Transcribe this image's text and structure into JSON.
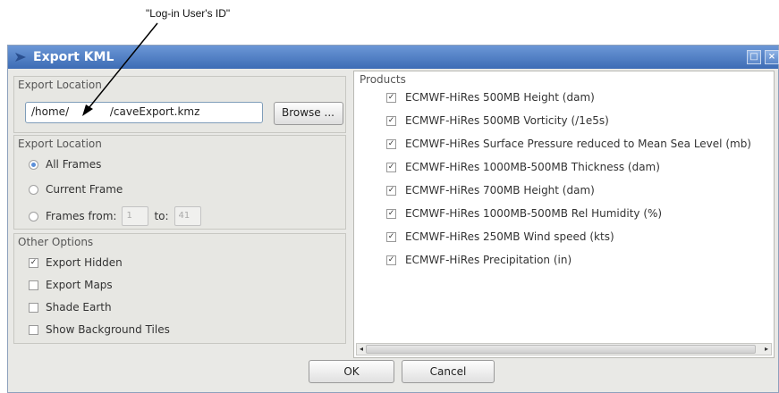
{
  "annotation": {
    "text": "\"Log-in User's ID\""
  },
  "window": {
    "title": "Export KML",
    "buttons": {
      "maximize": "□",
      "close": "×"
    }
  },
  "export_location_path": {
    "label": "Export Location",
    "value": "/home/            /caveExport.kmz",
    "browse_label": "Browse ..."
  },
  "export_frames": {
    "label": "Export Location",
    "options": [
      {
        "label": "All Frames",
        "selected": true
      },
      {
        "label": "Current Frame",
        "selected": false
      },
      {
        "label": "Frames  from:",
        "selected": false
      }
    ],
    "from_value": "1",
    "to_label": "to:",
    "to_value": "41"
  },
  "other_options": {
    "label": "Other Options",
    "items": [
      {
        "label": "Export Hidden",
        "checked": true
      },
      {
        "label": "Export Maps",
        "checked": false
      },
      {
        "label": "Shade Earth",
        "checked": false
      },
      {
        "label": "Show Background Tiles",
        "checked": false
      }
    ]
  },
  "products": {
    "label": "Products",
    "items": [
      {
        "label": "ECMWF-HiRes 500MB Height  (dam)",
        "checked": true
      },
      {
        "label": "ECMWF-HiRes 500MB Vorticity  (/1e5s)",
        "checked": true
      },
      {
        "label": "ECMWF-HiRes Surface Pressure reduced to Mean Sea Level  (mb)",
        "checked": true
      },
      {
        "label": "ECMWF-HiRes 1000MB-500MB Thickness  (dam)",
        "checked": true
      },
      {
        "label": "ECMWF-HiRes 700MB Height  (dam)",
        "checked": true
      },
      {
        "label": "ECMWF-HiRes 1000MB-500MB Rel Humidity  (%)",
        "checked": true
      },
      {
        "label": "ECMWF-HiRes 250MB Wind speed  (kts)",
        "checked": true
      },
      {
        "label": "ECMWF-HiRes Precipitation  (in)",
        "checked": true
      }
    ]
  },
  "footer": {
    "ok_label": "OK",
    "cancel_label": "Cancel"
  },
  "colors": {
    "titlebar": "#3d6cb5",
    "radio_selected": "#5b8fd9"
  }
}
